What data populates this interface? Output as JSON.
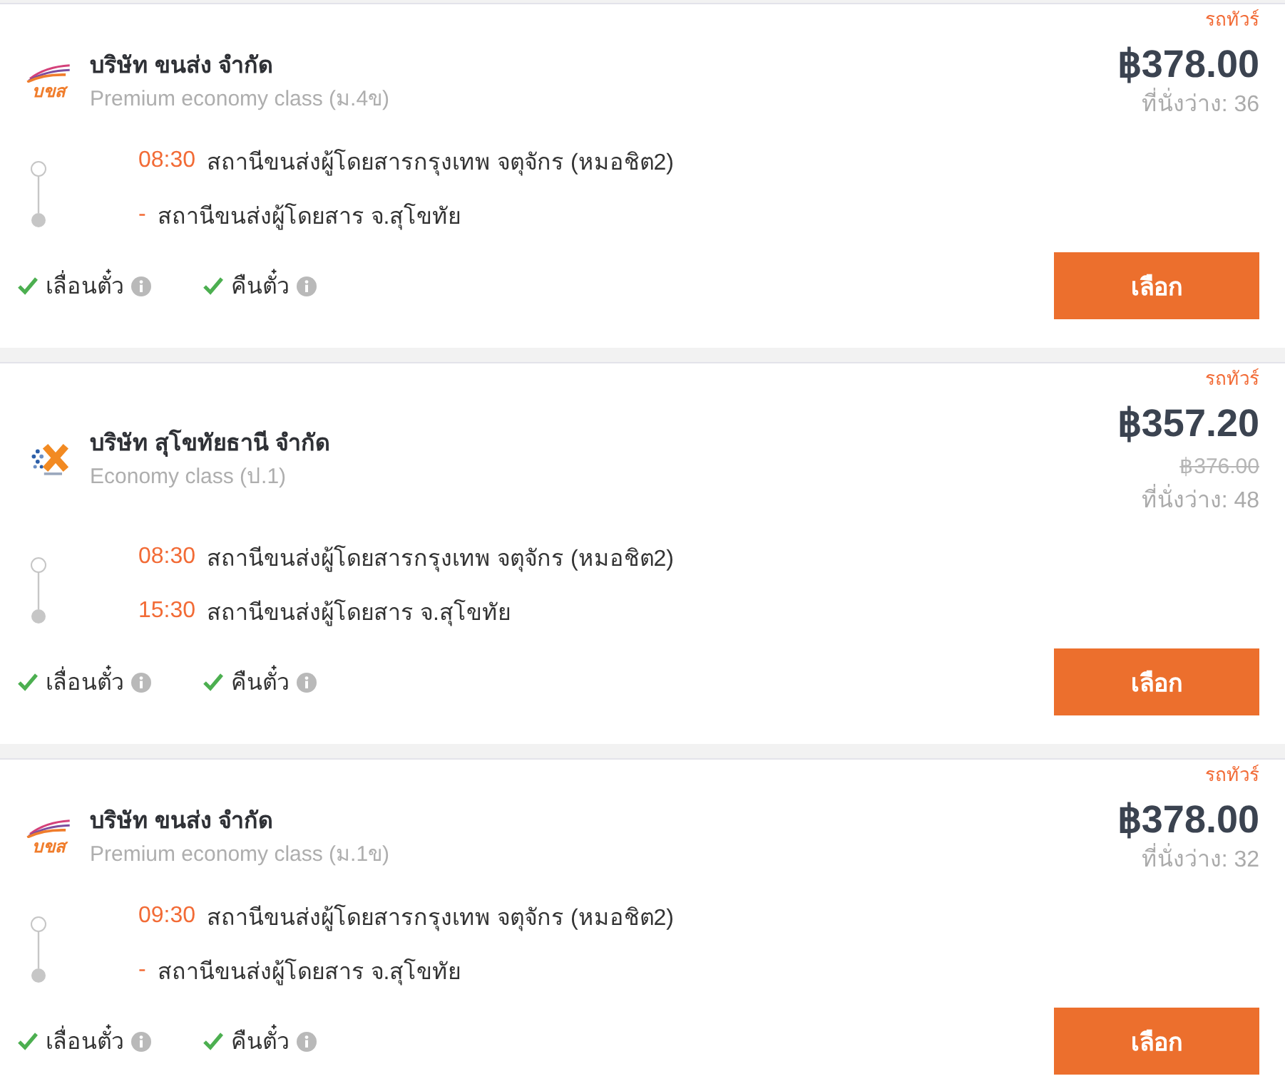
{
  "results": [
    {
      "logo": {
        "kind": "swoosh",
        "text": "บขส"
      },
      "operator": "บริษัท ขนส่ง จำกัด",
      "bus_class": "Premium economy class (ม.4ข)",
      "bus_type": "รถทัวร์",
      "price": "฿378.00",
      "seats": "ที่นั่งว่าง: 36",
      "stops": [
        {
          "time": "08:30",
          "station": "สถานีขนส่งผู้โดยสารกรุงเทพ จตุจักร (หมอชิต2)"
        },
        {
          "time": "-",
          "station": "สถานีขนส่งผู้โดยสาร จ.สุโขทัย"
        }
      ],
      "features": [
        {
          "label": "เลื่อนตั๋ว",
          "available": true
        },
        {
          "label": "คืนตั๋ว",
          "available": true
        }
      ],
      "button": "เลือก"
    },
    {
      "logo": {
        "kind": "x-mark"
      },
      "operator": "บริษัท สุโขทัยธานี จำกัด",
      "bus_class": "Economy class (ป.1)",
      "bus_type": "รถทัวร์",
      "price": "฿357.20",
      "original_price": "฿376.00",
      "seats": "ที่นั่งว่าง: 48",
      "stops": [
        {
          "time": "08:30",
          "station": "สถานีขนส่งผู้โดยสารกรุงเทพ จตุจักร (หมอชิต2)"
        },
        {
          "time": "15:30",
          "station": "สถานีขนส่งผู้โดยสาร จ.สุโขทัย"
        }
      ],
      "features": [
        {
          "label": "เลื่อนตั๋ว",
          "available": true
        },
        {
          "label": "คืนตั๋ว",
          "available": true
        }
      ],
      "button": "เลือก"
    },
    {
      "logo": {
        "kind": "swoosh",
        "text": "บขส"
      },
      "operator": "บริษัท ขนส่ง จำกัด",
      "bus_class": "Premium economy class (ม.1ข)",
      "bus_type": "รถทัวร์",
      "price": "฿378.00",
      "seats": "ที่นั่งว่าง: 32",
      "stops": [
        {
          "time": "09:30",
          "station": "สถานีขนส่งผู้โดยสารกรุงเทพ จตุจักร (หมอชิต2)"
        },
        {
          "time": "-",
          "station": "สถานีขนส่งผู้โดยสาร จ.สุโขทัย"
        }
      ],
      "features": [
        {
          "label": "เลื่อนตั๋ว",
          "available": true
        },
        {
          "label": "คืนตั๋ว",
          "available": true
        }
      ],
      "button": "เลือก"
    }
  ]
}
